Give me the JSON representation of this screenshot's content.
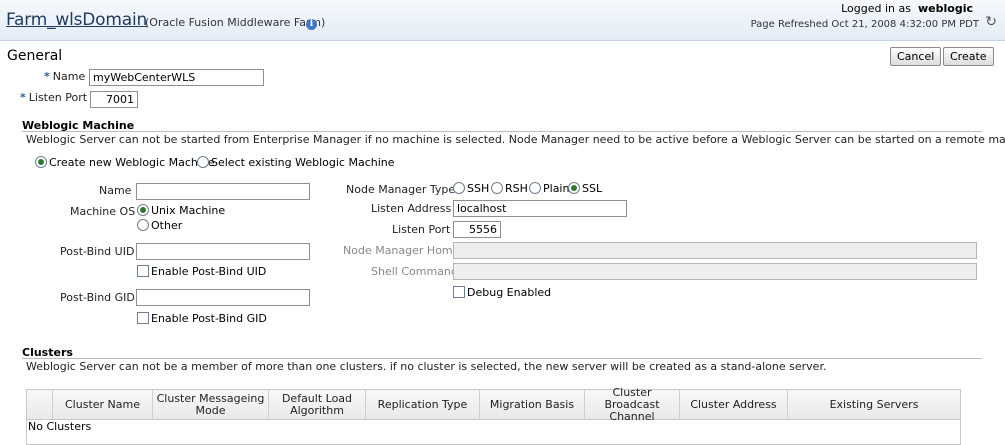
{
  "header": {
    "farm_title": "Farm_wlsDomain",
    "farm_subtitle": "(Oracle Fusion Middleware Farm)",
    "logged_in_label": "Logged in as",
    "logged_in_user": "weblogic",
    "page_refreshed": "Page Refreshed Oct 21, 2008 4:32:00 PM PDT"
  },
  "buttons": {
    "cancel": "Cancel",
    "create": "Create"
  },
  "general": {
    "title": "General",
    "required_marker": "*",
    "name_label": "Name",
    "name_value": "myWebCenterWLS",
    "listen_port_label": "Listen Port",
    "listen_port_value": "7001"
  },
  "machine": {
    "title": "Weblogic Machine",
    "description": "Weblogic Server can not be started from Enterprise Manager if no machine is selected. Node Manager need to be active before a Weblogic Server can be started on a remote machine.",
    "create_new_label": "Create new Weblogic Machine",
    "select_existing_label": "Select existing Weblogic Machine",
    "name_label": "Name",
    "name_value": "",
    "machine_os_label": "Machine OS",
    "os_unix": "Unix Machine",
    "os_other": "Other",
    "post_bind_uid_label": "Post-Bind UID",
    "post_bind_uid_value": "",
    "enable_uid_label": "Enable Post-Bind UID",
    "post_bind_gid_label": "Post-Bind GID",
    "post_bind_gid_value": "",
    "enable_gid_label": "Enable Post-Bind GID",
    "node_manager_type_label": "Node Manager Type",
    "nm_ssh": "SSH",
    "nm_rsh": "RSH",
    "nm_plain": "Plain",
    "nm_ssl": "SSL",
    "listen_address_label": "Listen Address",
    "listen_address_value": "localhost",
    "listen_port_label": "Listen Port",
    "listen_port_value": "5556",
    "node_manager_home_label": "Node Manager Home",
    "node_manager_home_value": "",
    "shell_command_label": "Shell Command",
    "shell_command_value": "",
    "debug_enabled_label": "Debug Enabled"
  },
  "clusters": {
    "title": "Clusters",
    "description": "Weblogic Server can not be a member of more than one clusters. if no cluster is selected, the new server will be created as a stand-alone server.",
    "columns": [
      "Cluster Name",
      "Cluster Messageing Mode",
      "Default Load Algorithm",
      "Replication Type",
      "Migration Basis",
      "Cluster Broadcast Channel",
      "Cluster Address",
      "Existing Servers"
    ],
    "empty_text": "No Clusters"
  }
}
